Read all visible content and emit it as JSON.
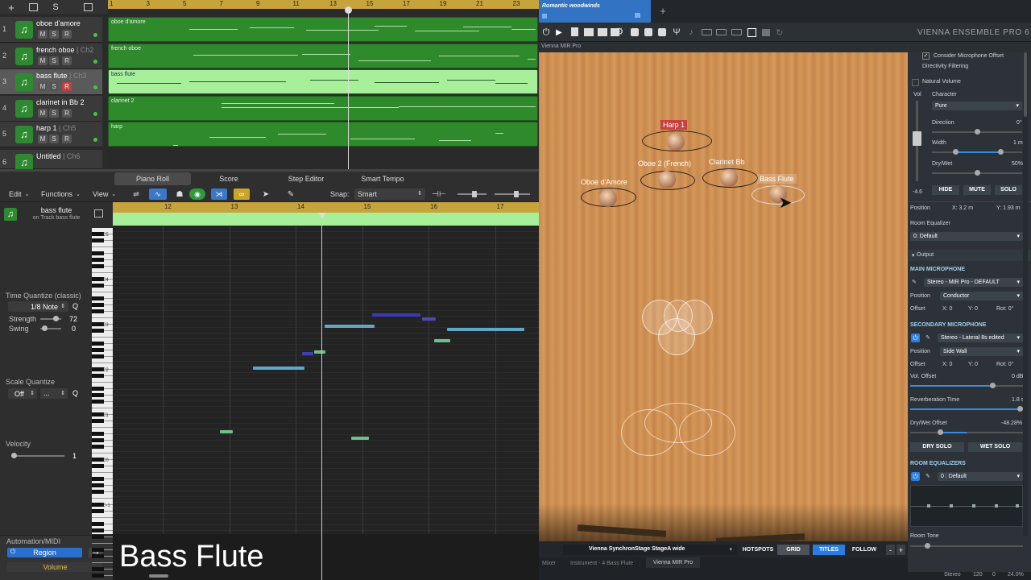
{
  "logic": {
    "ruler_marks": [
      "1",
      "3",
      "5",
      "7",
      "9",
      "11",
      "13",
      "15",
      "17",
      "19",
      "21",
      "23"
    ],
    "tracks": [
      {
        "num": "1",
        "name": "oboe d'amore",
        "ch": "",
        "region": "oboe d'amore",
        "rec": false
      },
      {
        "num": "2",
        "name": "french oboe",
        "ch": "| Ch2",
        "region": "french oboe",
        "rec": false
      },
      {
        "num": "3",
        "name": "bass flute",
        "ch": "| Ch3",
        "region": "bass flute",
        "rec": true
      },
      {
        "num": "4",
        "name": "clarinet in Bb 2",
        "ch": "",
        "region": "clarinet 2",
        "rec": false
      },
      {
        "num": "5",
        "name": "harp 1",
        "ch": "| Ch5",
        "region": "harp",
        "rec": false
      }
    ],
    "track6": {
      "num": "6",
      "name": "Untitled",
      "ch": "| Ch6"
    },
    "btn_m": "M",
    "btn_s": "S",
    "btn_r": "R",
    "tabs": [
      "Piano Roll",
      "Score",
      "Step Editor",
      "Smart Tempo"
    ],
    "menu": {
      "edit": "Edit",
      "functions": "Functions",
      "view": "View",
      "snap_label": "Snap:",
      "snap_value": "Smart"
    },
    "region_info": {
      "name": "bass flute",
      "track": "on Track bass flute"
    },
    "pr_ruler": [
      "12",
      "13",
      "14",
      "15",
      "16",
      "17"
    ],
    "octaves": [
      "C5",
      "C4",
      "C3",
      "C2",
      "C1",
      "C0",
      "C-1"
    ],
    "quantize": {
      "title": "Time Quantize (classic)",
      "value": "1/8 Note",
      "q": "Q",
      "strength_label": "Strength",
      "strength": "72",
      "swing_label": "Swing",
      "swing": "0"
    },
    "scale": {
      "title": "Scale Quantize",
      "value": "Off",
      "q": "Q"
    },
    "velocity": {
      "title": "Velocity",
      "value": "1"
    },
    "automation": {
      "title": "Automation/MIDI",
      "region": "Region",
      "param": "Volume"
    },
    "caption": "Bass Flute"
  },
  "vep": {
    "tab": "Romantic woodwinds",
    "brand": "VIENNA ENSEMBLE PRO 6",
    "plugin": "Vienna MIR Pro",
    "instruments": [
      "Harp 1",
      "Oboe 2 (French)",
      "Clarinet Bb",
      "Oboe d'Amore",
      "Bass Flute"
    ],
    "bottom": {
      "stage": "Vienna SynchronStage StageA wide",
      "hotspots": "HOTSPOTS",
      "grid": "GRID",
      "titles": "TITLES",
      "follow": "FOLLOW",
      "minus": "-",
      "plus": "+"
    },
    "status": {
      "mixer": "Mixer",
      "instrument": "Instrument - 4 Bass Flute",
      "mir": "Vienna MIR Pro",
      "mode": "Stereo",
      "tempo": "120",
      "zero": "0",
      "zoom": "24.0%"
    }
  },
  "panel": {
    "consider": "Consider Microphone Offset",
    "directivity": "Directivity Filtering",
    "natural": "Natural Volume",
    "vol": "Vol",
    "character": "Character",
    "character_val": "Pure",
    "direction": "Direction",
    "direction_val": "0°",
    "width": "Width",
    "width_val": "1 m",
    "drywet": "Dry/Wet",
    "drywet_val": "50%",
    "level": "-4.6",
    "hide": "HIDE",
    "mute": "MUTE",
    "solo": "SOLO",
    "position": "Position",
    "x": "X:  3.2 m",
    "y": "Y:  1.93 m",
    "room_eq": "Room Equalizer",
    "room_eq_val": "0: Default",
    "output": "Output",
    "main_mic": "MAIN MICROPHONE",
    "main_mic_val": "Stereo - MIR Pro - DEFAULT",
    "main_pos": "Conductor",
    "offset": "Offset",
    "ox": "X:  0",
    "oy": "Y:  0",
    "rot": "Rot:  0°",
    "sec_mic": "SECONDARY MICROPHONE",
    "sec_mic_val": "Stereo - Lateral 8s edited",
    "sec_pos": "Side Wall",
    "vol_offset": "Vol. Offset",
    "vol_offset_val": "0 dB",
    "reverb": "Reverberation Time",
    "reverb_val": "1.8 s",
    "dw_offset": "Dry/Wet Offset",
    "dw_offset_val": "-48.28%",
    "dry_solo": "DRY SOLO",
    "wet_solo": "WET SOLO",
    "room_eqs": "ROOM EQUALIZERS",
    "room_eqs_val": "0 : Default",
    "room_tone": "Room Tone"
  }
}
